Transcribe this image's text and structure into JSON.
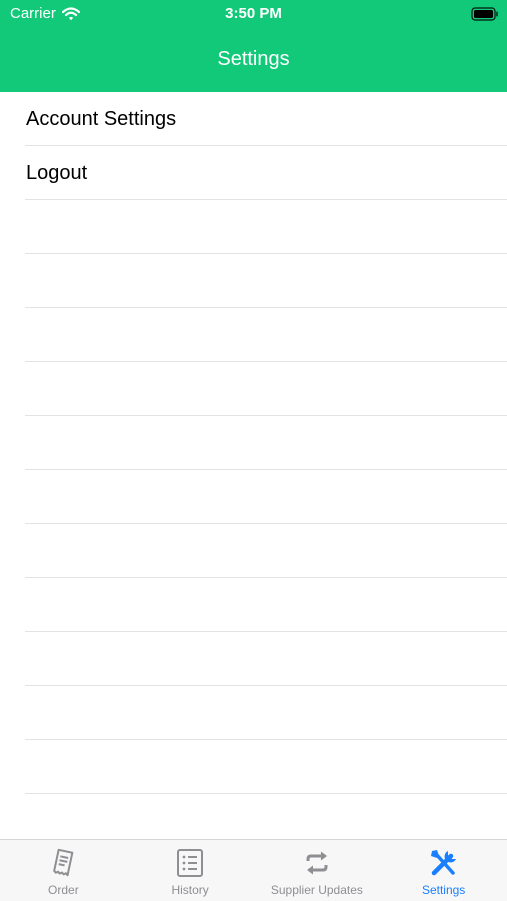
{
  "status_bar": {
    "carrier": "Carrier",
    "time": "3:50 PM"
  },
  "nav": {
    "title": "Settings",
    "background_color": "#12c97a"
  },
  "settings_list": {
    "items": [
      {
        "label": "Account Settings"
      },
      {
        "label": "Logout"
      }
    ]
  },
  "tab_bar": {
    "active_color": "#1a7fff",
    "inactive_color": "#8e8e93",
    "tabs": [
      {
        "label": "Order",
        "icon": "receipt-icon",
        "active": false
      },
      {
        "label": "History",
        "icon": "list-icon",
        "active": false
      },
      {
        "label": "Supplier Updates",
        "icon": "refresh-arrows-icon",
        "active": false
      },
      {
        "label": "Settings",
        "icon": "wrench-screwdriver-icon",
        "active": true
      }
    ]
  }
}
